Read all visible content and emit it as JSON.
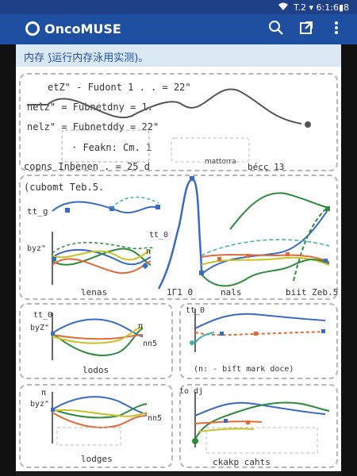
{
  "status": {
    "right_text": "T.2  ▾ 6:1:6▮8"
  },
  "app": {
    "title": "OncoMUSE"
  },
  "banner": {
    "text": "内存 ⟆运行内存泳用实测)。"
  },
  "config_lines": [
    "etZ\" - Fudont 1   .  .  = 22\"",
    "nelz\" = Fubnetdny  =  1.",
    "nelz\" = Fubnetddy  =  22\"",
    "· Feakn:  Cm. 1",
    "copns  Inbenen   .  = 25 d",
    "(cubomt  Teb.5."
  ],
  "labels": {
    "mattorra": "mattorra",
    "becc": "bécç  13",
    "leng": "lenas",
    "tr": "1Г1 0",
    "nals": "nals",
    "bitzeb": "biit Zeb.5",
    "lodos": "lodos",
    "nn": "nn5",
    "bift": "(n: - bift mark  doce)",
    "lodges": "lodges",
    "ckakp": "ckakp    cahts",
    "ttg1": "tt_g",
    "tto": "tt_0",
    "tto2": "tt_0",
    "tto3": "tt_0",
    "todj": "to dj",
    "byz1": "byz\"",
    "byz2": "byZ\"",
    "byz3": "byz\"",
    "pi1": "π",
    "pi2": "π",
    "pi3": "π",
    "nn5b": "nn5",
    "nn5c": "nn5"
  },
  "colors": {
    "blue": "#3a6bc2",
    "green": "#2e8b3a",
    "orange": "#e06a3a",
    "yellow": "#c9c224",
    "teal": "#3ab3a6",
    "gray": "#555555"
  }
}
